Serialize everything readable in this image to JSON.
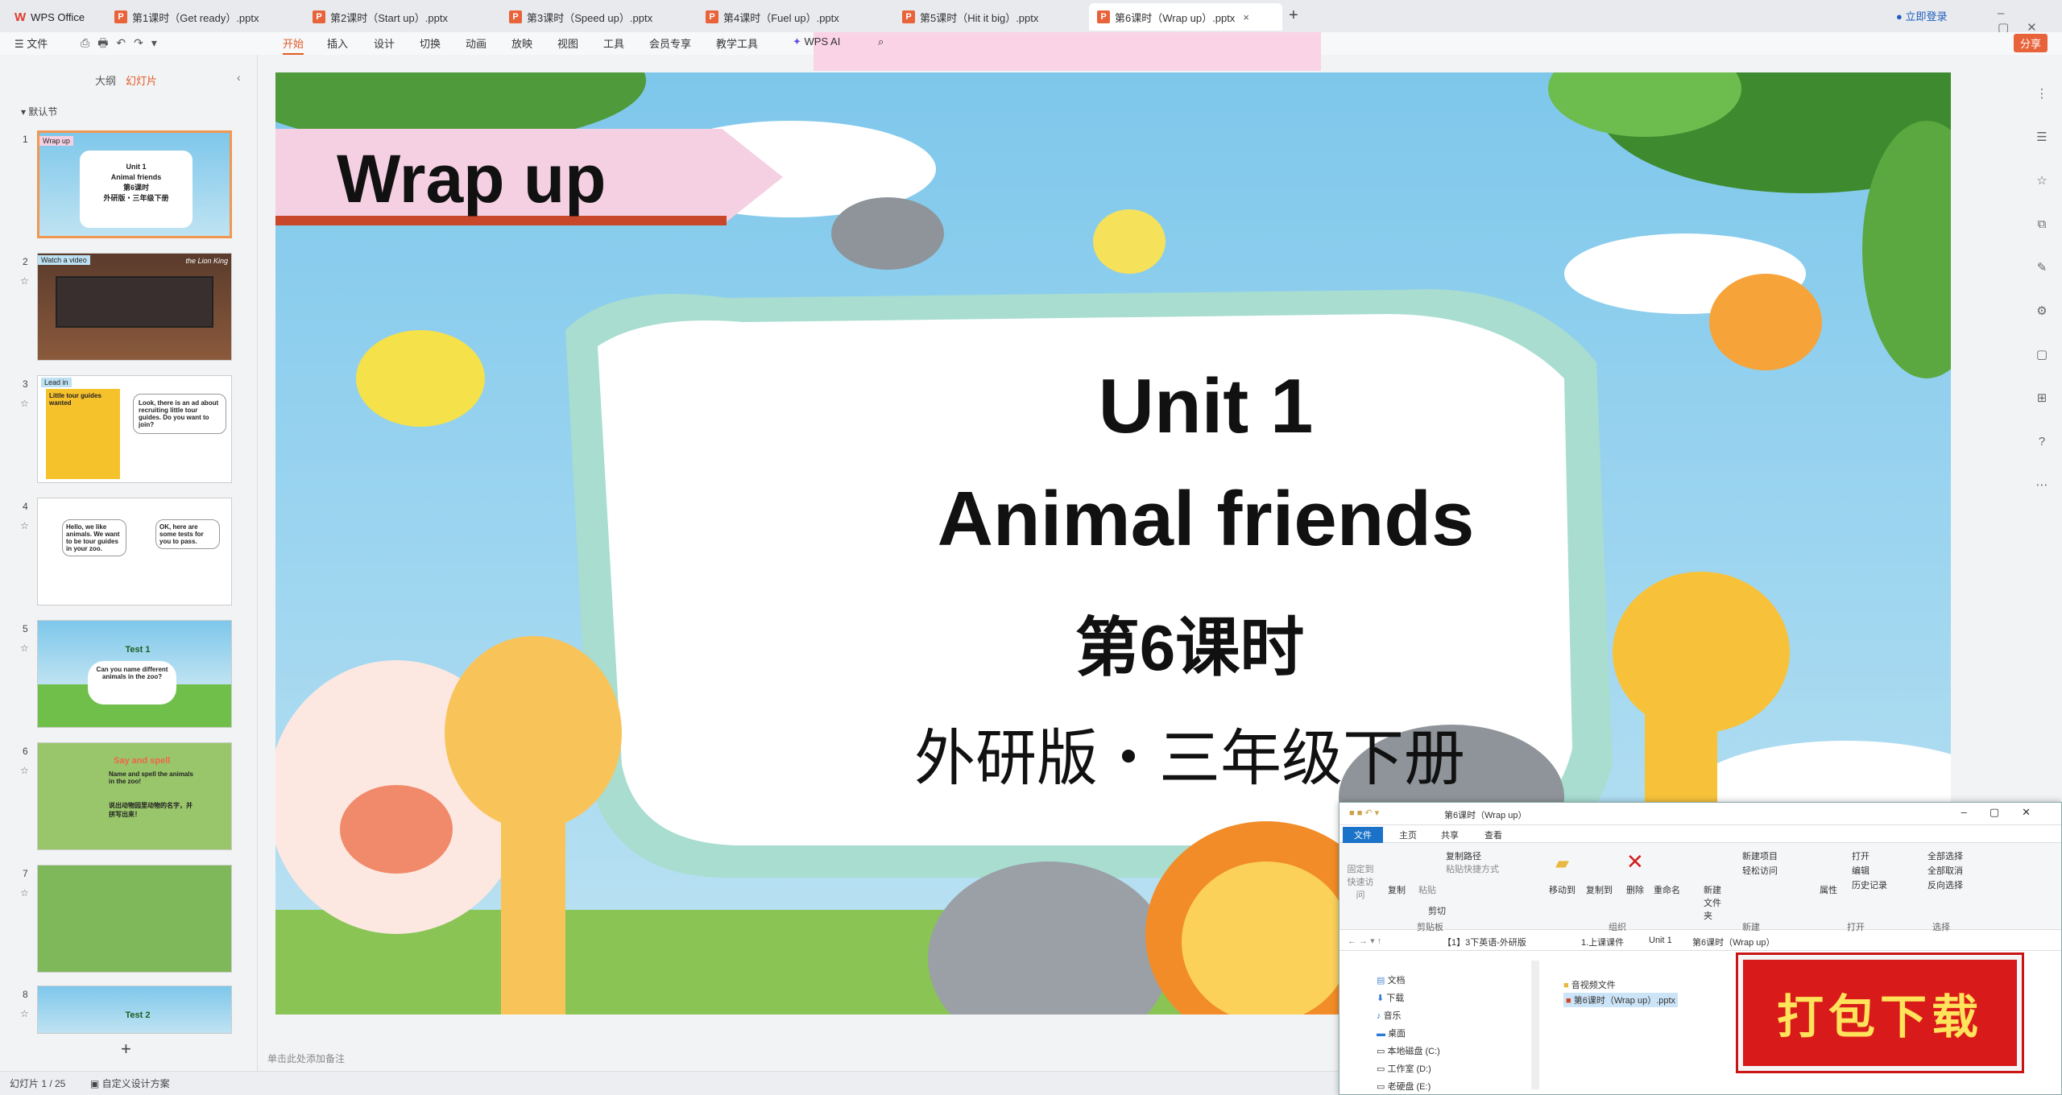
{
  "app": {
    "name": "WPS Office"
  },
  "tabs": [
    {
      "label": "第1课时（Get ready）.pptx"
    },
    {
      "label": "第2课时（Start up）.pptx"
    },
    {
      "label": "第3课时（Speed up）.pptx"
    },
    {
      "label": "第4课时（Fuel up）.pptx"
    },
    {
      "label": "第5课时（Hit it big）.pptx"
    },
    {
      "label": "第6课时（Wrap up）.pptx"
    }
  ],
  "account": {
    "login": "立即登录"
  },
  "share": {
    "label": "分享"
  },
  "menu": {
    "file": "文件",
    "items": [
      "开始",
      "插入",
      "设计",
      "切换",
      "动画",
      "放映",
      "视图",
      "工具",
      "会员专享",
      "教学工具"
    ],
    "ai": "WPS AI"
  },
  "leftpanel": {
    "outline_tab": "大纲",
    "slides_tab": "幻灯片",
    "section": "默认节",
    "thumbnails": [
      {
        "n": "1",
        "title": "Wrap up",
        "lines": [
          "Unit 1",
          "Animal friends",
          "第6课时",
          "外研版・三年级下册"
        ]
      },
      {
        "n": "2",
        "title": "Watch a video",
        "extra": "the Lion King"
      },
      {
        "n": "3",
        "title": "Lead in",
        "lines": [
          "Little tour guides wanted",
          "Look, there is an ad about recruiting little tour guides. Do you want to join?"
        ]
      },
      {
        "n": "4",
        "lines": [
          "Hello, we like animals. We want to be tour guides in your zoo.",
          "OK, here are some tests for you to pass."
        ]
      },
      {
        "n": "5",
        "title": "Test 1",
        "lines": [
          "Can you name different animals in the zoo?"
        ]
      },
      {
        "n": "6",
        "title": "Say and spell",
        "lines": [
          "Name and spell the animals in the zoo!",
          "说出动物园里动物的名字，并拼写出来！"
        ]
      },
      {
        "n": "7"
      },
      {
        "n": "8",
        "title": "Test 2"
      }
    ],
    "add": "+"
  },
  "slide": {
    "banner": "Wrap up",
    "unit": "Unit 1",
    "title": "Animal friends",
    "lesson": "第6课时",
    "edition": "外研版・三年级下册"
  },
  "notes": {
    "placeholder": "单击此处添加备注"
  },
  "status": {
    "slide_count": "幻灯片 1 / 25",
    "design": "自定义设计方案"
  },
  "explorer": {
    "title": "第6课时（Wrap up）",
    "ribbon_tabs": [
      "文件",
      "主页",
      "共享",
      "查看"
    ],
    "groups": {
      "clipboard": "剪贴板",
      "organize": "组织",
      "new": "新建",
      "open": "打开",
      "select": "选择"
    },
    "buttons": {
      "pin": "固定到快速访问",
      "copy": "复制",
      "paste": "粘贴",
      "copy_path": "复制路径",
      "paste_shortcut": "粘贴快捷方式",
      "cut": "剪切",
      "move_to": "移动到",
      "copy_to": "复制到",
      "delete": "删除",
      "rename": "重命名",
      "new_folder": "新建文件夹",
      "new_item": "新建项目",
      "easy_access": "轻松访问",
      "properties": "属性",
      "open": "打开",
      "edit": "编辑",
      "history": "历史记录",
      "select_all": "全部选择",
      "select_none": "全部取消",
      "invert": "反向选择"
    },
    "breadcrumb": [
      "【1】3下英语-外研版",
      "1.上课课件",
      "Unit 1",
      "第6课时（Wrap up）"
    ],
    "nav": [
      "文档",
      "下载",
      "音乐",
      "桌面",
      "本地磁盘 (C:)",
      "工作室 (D:)",
      "老硬盘 (E:)"
    ],
    "files": [
      "音视频文件",
      "第6课时（Wrap up）.pptx"
    ]
  },
  "download_badge": "打包下载"
}
